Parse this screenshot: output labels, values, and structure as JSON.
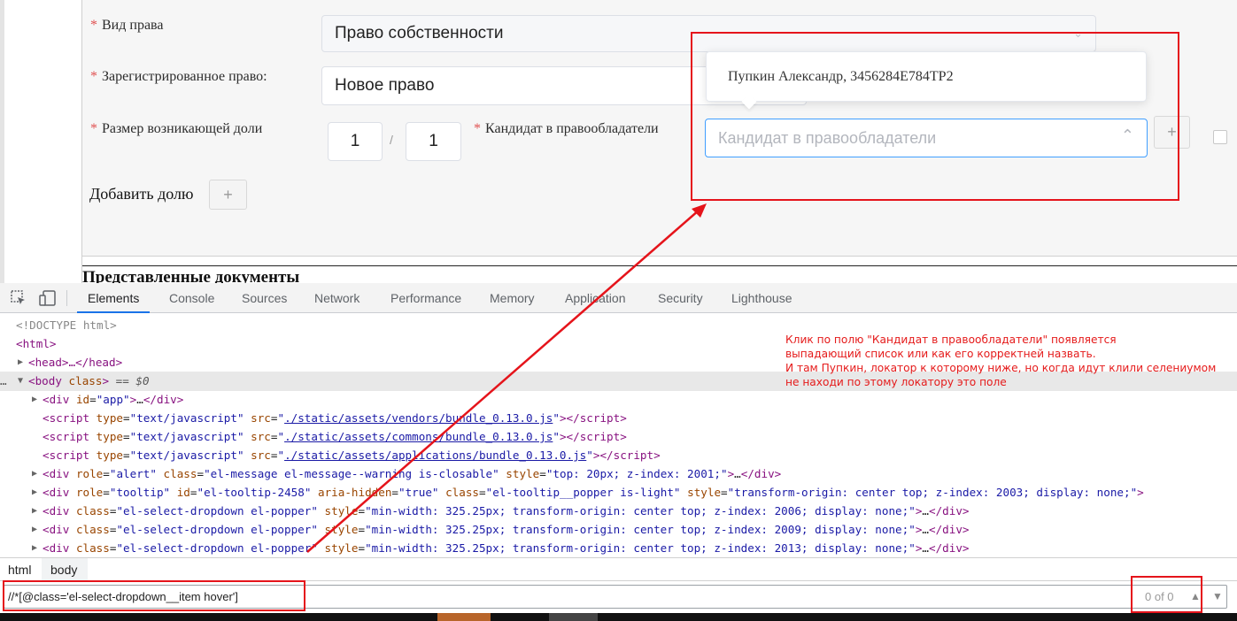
{
  "form": {
    "right_type_label": "Вид права",
    "right_type_value": "Право собственности",
    "registered_right_label": "Зарегистрированное право:",
    "registered_right_value": "Новое право",
    "share_size_label": "Размер возникающей доли",
    "share_numerator": "1",
    "share_separator": "/",
    "share_denominator": "1",
    "candidate_label": "Кандидат в правообладатели",
    "candidate_placeholder": "Кандидат в правообладатели",
    "dropdown_item": "Пупкин Александр, 3456284E784TP2",
    "add_share_label": "Добавить долю",
    "plus": "+",
    "documents_heading": "Представленные документы"
  },
  "devtools": {
    "tabs": [
      "Elements",
      "Console",
      "Sources",
      "Network",
      "Performance",
      "Memory",
      "Application",
      "Security",
      "Lighthouse"
    ],
    "active_tab": "Elements",
    "code": {
      "doctype": "<!DOCTYPE html>",
      "html_open": "<html>",
      "head": "<head>…</head>",
      "body_tag": "body",
      "body_attr": "class",
      "body_suffix": "== $0",
      "div_app_id": "app",
      "script_attr_type": "type",
      "script_type": "text/javascript",
      "script_attr_src": "src",
      "script1_src": "./static/assets/vendors/bundle_0.13.0.js",
      "script2_src": "./static/assets/commons/bundle_0.13.0.js",
      "script3_src": "./static/assets/applications/bundle_0.13.0.js",
      "alert_class": "el-message el-message--warning is-closable",
      "alert_style": "top: 20px; z-index: 2001;",
      "tooltip_id": "el-tooltip-2458",
      "tooltip_class": "el-tooltip__popper is-light",
      "tooltip_style": "transform-origin: center top; z-index: 2003; display: none;",
      "dropdown_class": "el-select-dropdown el-popper",
      "dropdown1_style": "min-width: 325.25px; transform-origin: center top; z-index: 2006; display: none;",
      "dropdown2_style": "min-width: 325.25px; transform-origin: center top; z-index: 2009; display: none;",
      "dropdown3_style": "min-width: 325.25px; transform-origin: center top; z-index: 2013; display: none;"
    },
    "breadcrumbs": [
      "html",
      "body"
    ],
    "search_query": "//*[@class='el-select-dropdown__item hover']",
    "search_count": "0 of 0"
  },
  "annotation": {
    "line1": "Клик по полю \"Кандидат в правообладатели\" появляется",
    "line2": "выпадающий список или как его корректней назвать.",
    "line3": "И там Пупкин, локатор к которому ниже, но когда идут клили селениумом",
    "line4": "не находи по этому локатору это поле"
  },
  "colors": {
    "annotation_red": "#e5141b",
    "link": "#1a73e8",
    "tag": "#881280",
    "attr": "#994500",
    "value": "#1a1aa6"
  }
}
